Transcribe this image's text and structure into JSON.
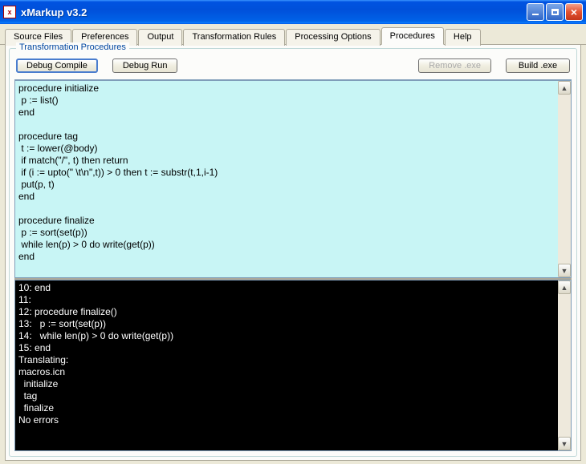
{
  "window": {
    "title": "xMarkup v3.2"
  },
  "tabs": {
    "t0": "Source Files",
    "t1": "Preferences",
    "t2": "Output",
    "t3": "Transformation Rules",
    "t4": "Processing Options",
    "t5": "Procedures",
    "t6": "Help",
    "active_index": 5
  },
  "group": {
    "legend": "Transformation Procedures",
    "btn_debug_compile": "Debug Compile",
    "btn_debug_run": "Debug Run",
    "btn_remove_exe": "Remove .exe",
    "btn_build_exe": "Build .exe"
  },
  "editor_text": "procedure initialize\n p := list()\nend\n\nprocedure tag\n t := lower(@body)\n if match(\"/\", t) then return\n if (i := upto(\" \\t\\n\",t)) > 0 then t := substr(t,1,i-1)\n put(p, t)\nend\n\nprocedure finalize\n p := sort(set(p))\n while len(p) > 0 do write(get(p))\nend",
  "output_text": "10: end\n11:\n12: procedure finalize()\n13:   p := sort(set(p))\n14:   while len(p) > 0 do write(get(p))\n15: end\nTranslating:\nmacros.icn\n  initialize\n  tag\n  finalize\nNo errors"
}
